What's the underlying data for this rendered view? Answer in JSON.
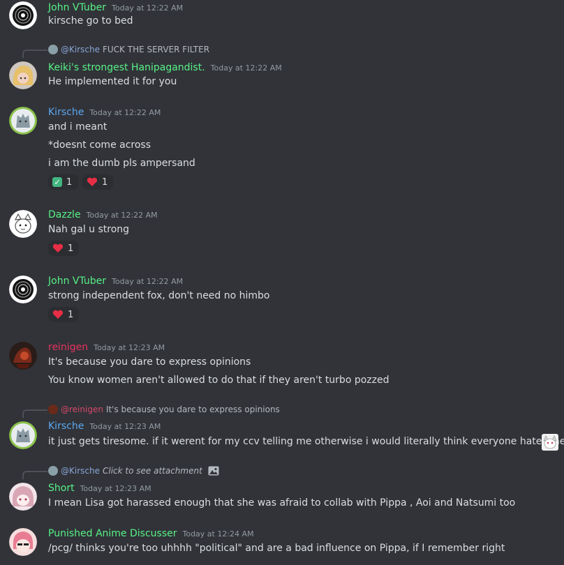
{
  "messages": [
    {
      "author": "John VTuber",
      "author_color": "#57f287",
      "time": "Today at 12:22 AM",
      "lines": [
        "kirsche go to bed"
      ]
    },
    {
      "author": "Keiki's strongest Hanipagandist.",
      "author_color": "#57f287",
      "time": "Today at 12:22 AM",
      "reply": {
        "name": "@Kirsche",
        "text": "FUCK THE SERVER FILTER"
      },
      "lines": [
        "He implemented it for you"
      ]
    },
    {
      "author": "Kirsche",
      "author_color": "#5ca7ef",
      "time": "Today at 12:22 AM",
      "lines": [
        "and i meant",
        "*doesnt come across",
        "i am the dumb pls ampersand"
      ],
      "reactions": [
        {
          "icon": "check-emoji",
          "count": "1"
        },
        {
          "icon": "heart-emoji",
          "count": "1"
        }
      ]
    },
    {
      "author": "Dazzle",
      "author_color": "#57f287",
      "time": "Today at 12:22 AM",
      "lines": [
        "Nah gal u strong"
      ],
      "reactions": [
        {
          "icon": "heart-emoji",
          "count": "1"
        }
      ]
    },
    {
      "author": "John VTuber",
      "author_color": "#57f287",
      "time": "Today at 12:22 AM",
      "lines": [
        "strong independent fox, don't need no himbo"
      ],
      "reactions": [
        {
          "icon": "heart-emoji",
          "count": "1"
        }
      ]
    },
    {
      "author": "reinigen",
      "author_color": "#e8335f",
      "time": "Today at 12:23 AM",
      "lines": [
        "It's because you dare to express opinions",
        "You know women aren't allowed to do that if they aren't turbo pozzed"
      ]
    },
    {
      "author": "Kirsche",
      "author_color": "#5ca7ef",
      "time": "Today at 12:23 AM",
      "reply": {
        "name": "@reinigen",
        "text": "It's because you dare to express opinions"
      },
      "lines": [
        "it just gets tiresome. if it werent for my ccv telling me otherwise i would literally think everyone hates me"
      ]
    },
    {
      "author": "Short",
      "author_color": "#57f287",
      "time": "Today at 12:23 AM",
      "reply": {
        "name": "@Kirsche",
        "text": "Click to see attachment"
      },
      "lines": [
        "I mean Lisa got harassed enough that she was afraid to collab with Pippa , Aoi and Natsumi too"
      ]
    },
    {
      "author": "Punished Anime Discusser",
      "author_color": "#57f287",
      "time": "Today at 12:24 AM",
      "lines": [
        "/pcg/ thinks you're too uhhhh \"political\" and are a bad influence on Pippa, if I remember right"
      ]
    }
  ]
}
